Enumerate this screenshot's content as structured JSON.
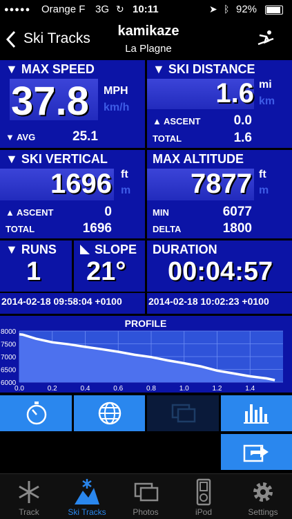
{
  "status": {
    "carrier": "Orange F",
    "network": "3G",
    "time": "10:11",
    "battery": "92%"
  },
  "nav": {
    "back_label": "Ski Tracks",
    "title": "kamikaze",
    "subtitle": "La Plagne"
  },
  "max_speed": {
    "title": "MAX SPEED",
    "value": "37.8",
    "unit_active": "MPH",
    "unit_alt": "km/h",
    "avg_label": "AVG",
    "avg_value": "25.1"
  },
  "ski_distance": {
    "title": "SKI DISTANCE",
    "value": "1.6",
    "unit_active": "mi",
    "unit_alt": "km",
    "ascent_label": "ASCENT",
    "ascent_value": "0.0",
    "total_label": "TOTAL",
    "total_value": "1.6"
  },
  "ski_vertical": {
    "title": "SKI VERTICAL",
    "value": "1696",
    "unit_active": "ft",
    "unit_alt": "m",
    "ascent_label": "ASCENT",
    "ascent_value": "0",
    "total_label": "TOTAL",
    "total_value": "1696"
  },
  "max_altitude": {
    "title": "MAX ALTITUDE",
    "value": "7877",
    "unit_active": "ft",
    "unit_alt": "m",
    "min_label": "MIN",
    "min_value": "6077",
    "delta_label": "DELTA",
    "delta_value": "1800"
  },
  "runs": {
    "title": "RUNS",
    "value": "1"
  },
  "slope": {
    "title": "SLOPE",
    "value": "21°"
  },
  "duration": {
    "title": "DURATION",
    "value": "00:04:57"
  },
  "timestamps": {
    "start": "2014-02-18 09:58:04 +0100",
    "end": "2014-02-18 10:02:23 +0100"
  },
  "chart_data": {
    "type": "area",
    "title": "PROFILE",
    "xlim": [
      0,
      1.6
    ],
    "ylim": [
      6000,
      8000
    ],
    "x_ticks": [
      "0.0",
      "0.2",
      "0.4",
      "0.6",
      "0.8",
      "1.0",
      "1.2",
      "1.4"
    ],
    "y_ticks": [
      "8000",
      "7500",
      "7000",
      "6500",
      "6000"
    ],
    "grid": true,
    "x": [
      0,
      0.02,
      0.1,
      0.2,
      0.3,
      0.4,
      0.5,
      0.6,
      0.7,
      0.8,
      0.9,
      1.0,
      1.1,
      1.2,
      1.3,
      1.4,
      1.5,
      1.55
    ],
    "values": [
      7870,
      7860,
      7700,
      7560,
      7480,
      7380,
      7290,
      7190,
      7070,
      6980,
      6850,
      6740,
      6620,
      6450,
      6340,
      6230,
      6150,
      6080
    ]
  },
  "actions": {
    "stopwatch": "stopwatch-icon",
    "map": "globe-icon",
    "photos": "photos-icon",
    "stats": "bar-chart-icon",
    "share": "share-icon"
  },
  "tabs": [
    {
      "label": "Track",
      "icon": "snowflake-icon"
    },
    {
      "label": "Ski Tracks",
      "icon": "ski-tracks-icon"
    },
    {
      "label": "Photos",
      "icon": "photos-icon"
    },
    {
      "label": "iPod",
      "icon": "ipod-icon"
    },
    {
      "label": "Settings",
      "icon": "gear-icon"
    }
  ],
  "colors": {
    "tile": "#0c14a6",
    "accent": "#2a87ee",
    "active_tab": "#2a87ee"
  }
}
